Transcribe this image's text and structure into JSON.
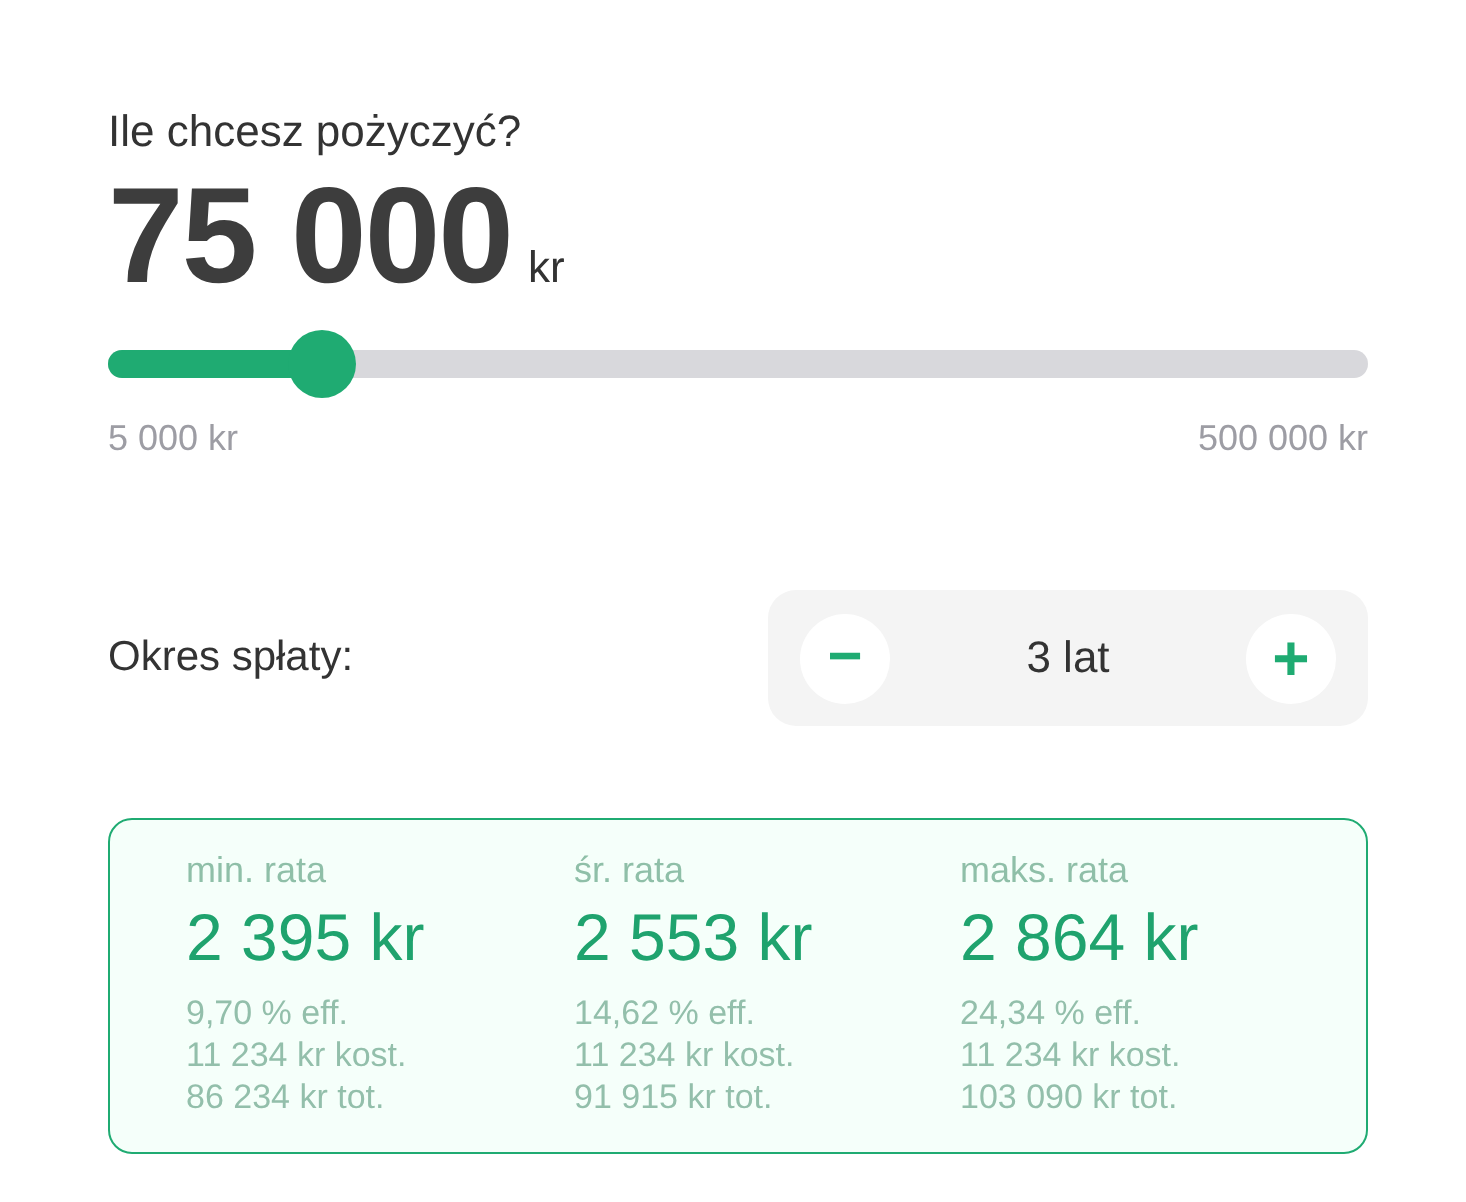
{
  "question": "Ile chcesz pożyczyć?",
  "amount": {
    "value": "75 000",
    "unit": "kr"
  },
  "slider": {
    "level": 0.17,
    "min_label": "5 000 kr",
    "max_label": "500 000 kr"
  },
  "term": {
    "label": "Okres spłaty:",
    "decrement": "−",
    "value": "3 lat",
    "increment": "+"
  },
  "rates": [
    {
      "label": "min. rata",
      "amount": "2 395 kr",
      "details": [
        "9,70 % eff.",
        "11 234 kr kost.",
        "86 234 kr tot."
      ]
    },
    {
      "label": "śr. rata",
      "amount": "2 553 kr",
      "details": [
        "14,62 % eff.",
        "11 234 kr kost.",
        "91 915 kr tot."
      ]
    },
    {
      "label": "maks. rata",
      "amount": "2 864 kr",
      "details": [
        "24,34 % eff.",
        "11 234 kr kost.",
        "103 090 kr tot."
      ]
    }
  ]
}
